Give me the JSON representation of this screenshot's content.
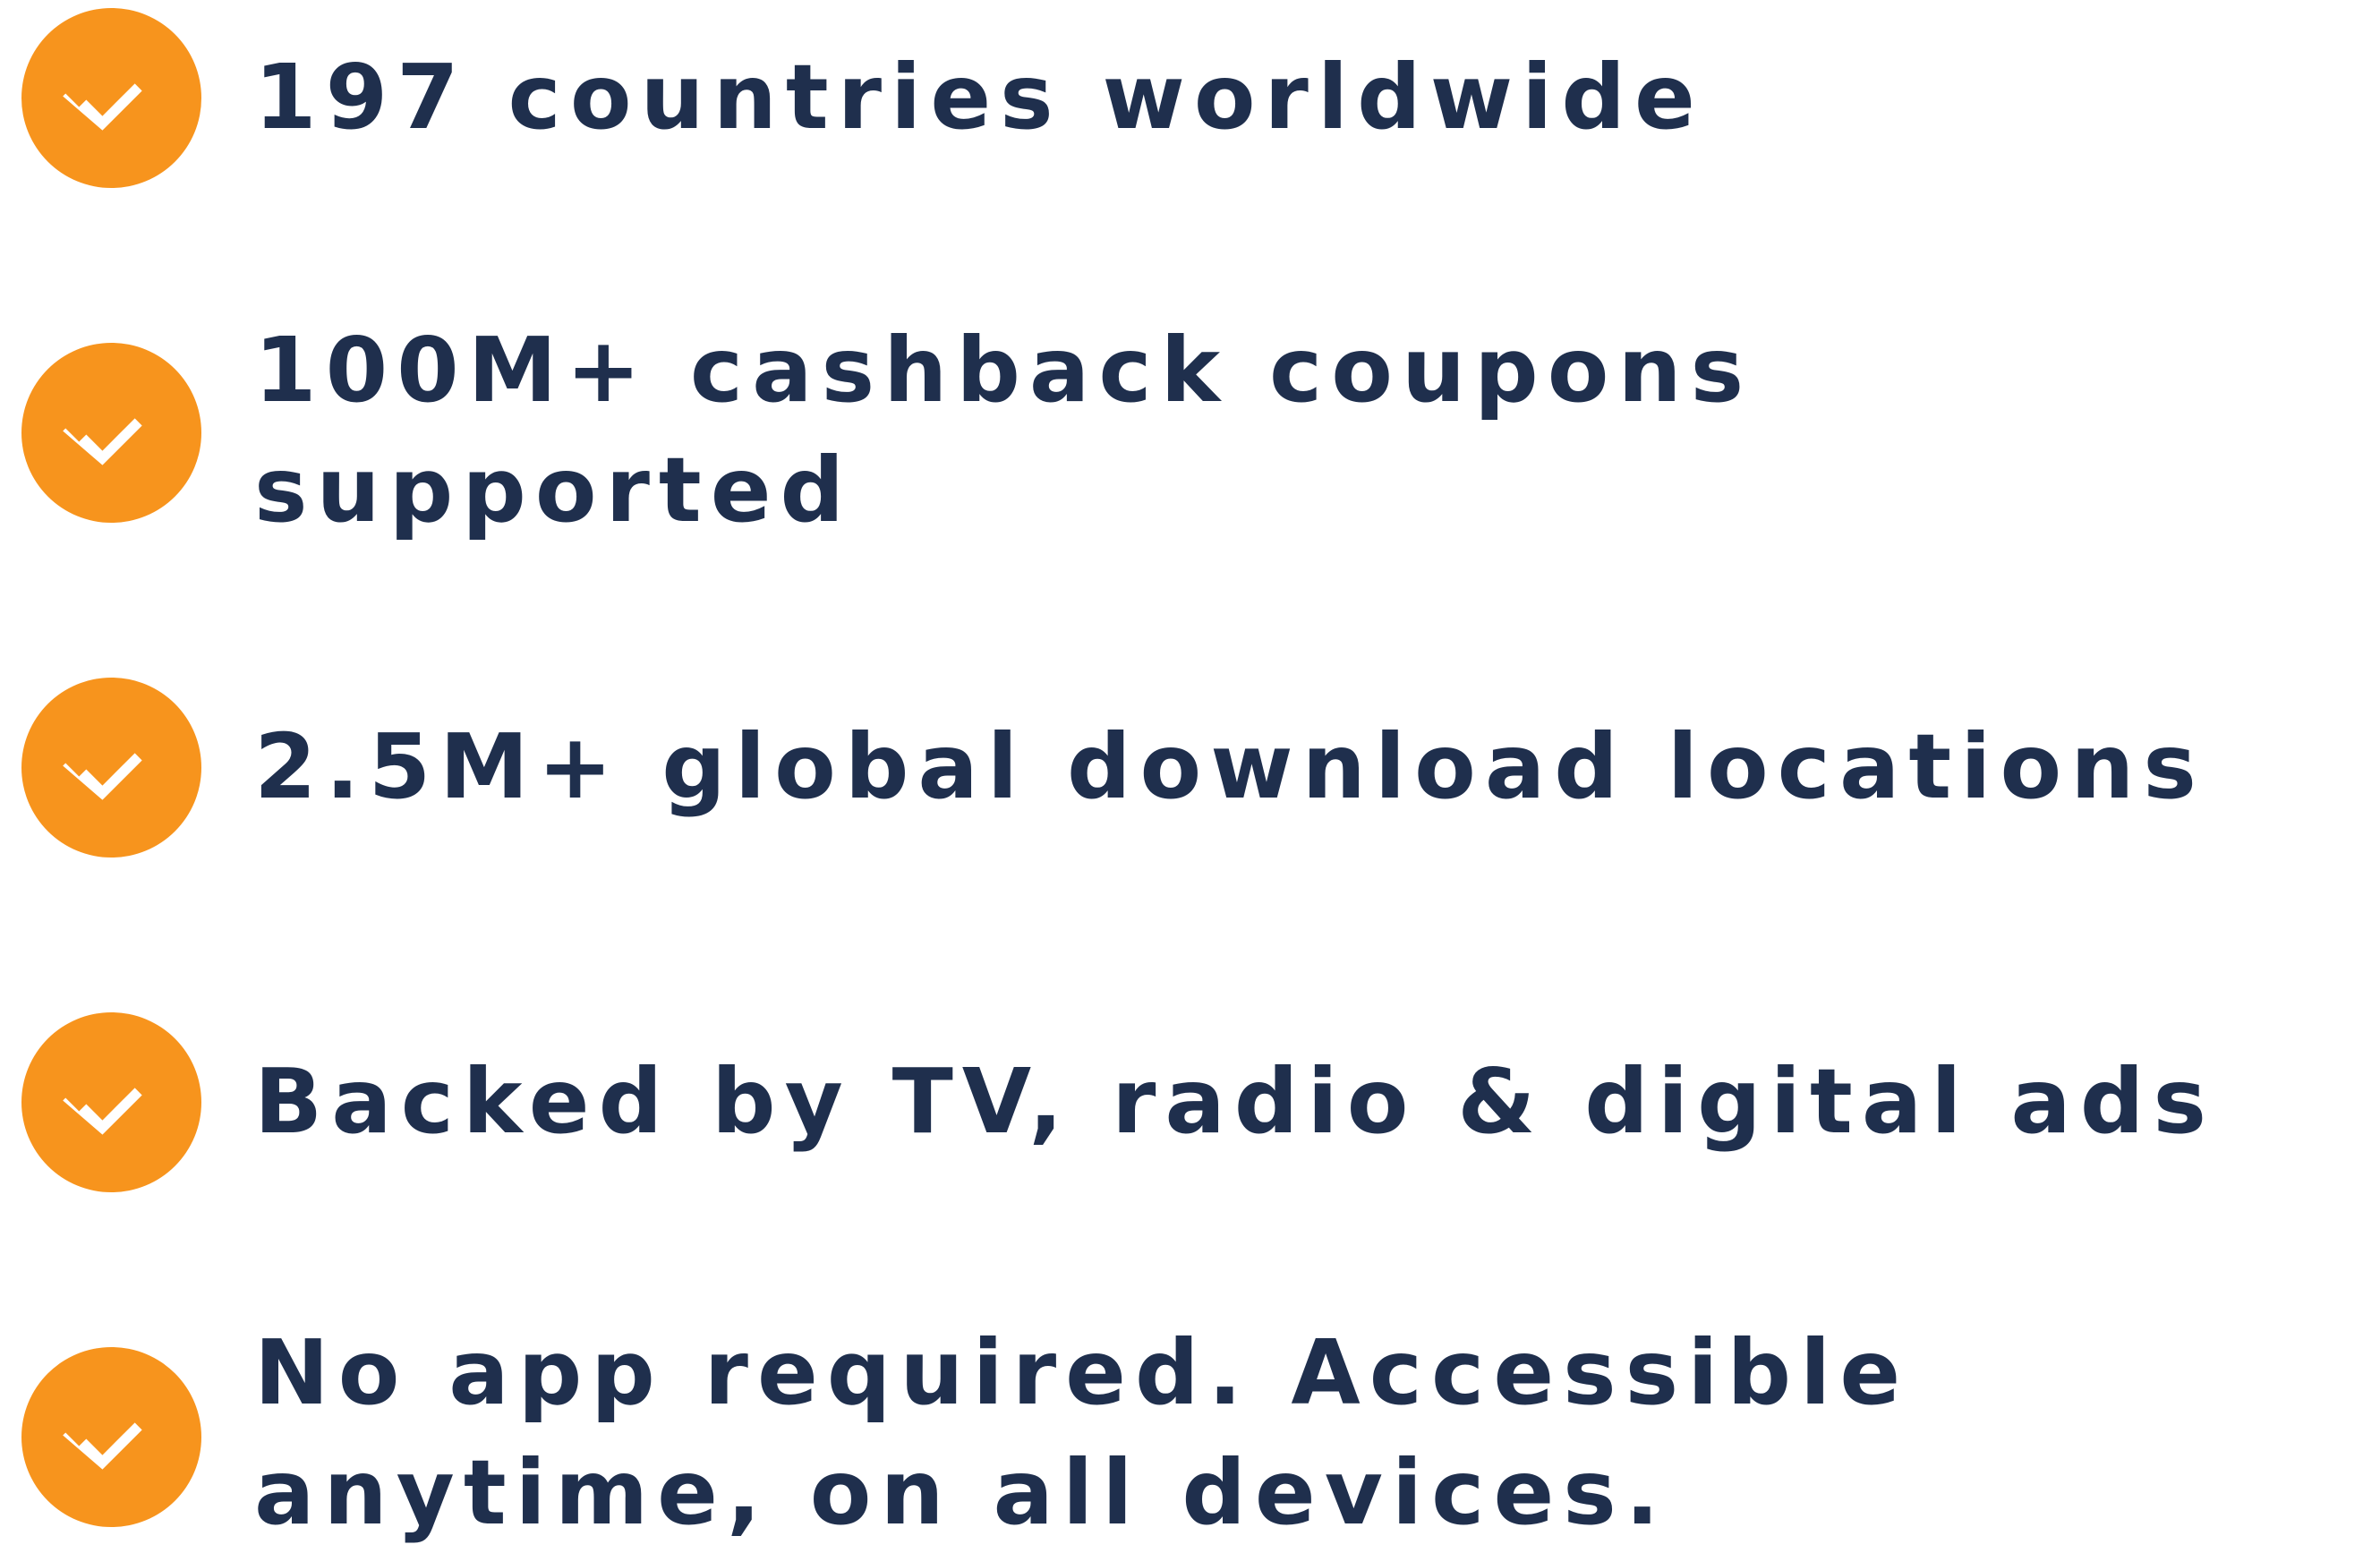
{
  "colors": {
    "badge": "#f7941d",
    "check": "#ffffff",
    "text": "#1f2f4d",
    "background": "#ffffff"
  },
  "icon": "check-circle-icon",
  "features": [
    {
      "lines": [
        "197 countries worldwide"
      ]
    },
    {
      "lines": [
        "100M+ cashback coupons",
        "supported"
      ]
    },
    {
      "lines": [
        "2.5M+ global download locations"
      ]
    },
    {
      "lines": [
        "Backed by TV, radio & digital ads"
      ]
    },
    {
      "lines": [
        "No app required. Accessible",
        "anytime, on all devices."
      ]
    }
  ]
}
